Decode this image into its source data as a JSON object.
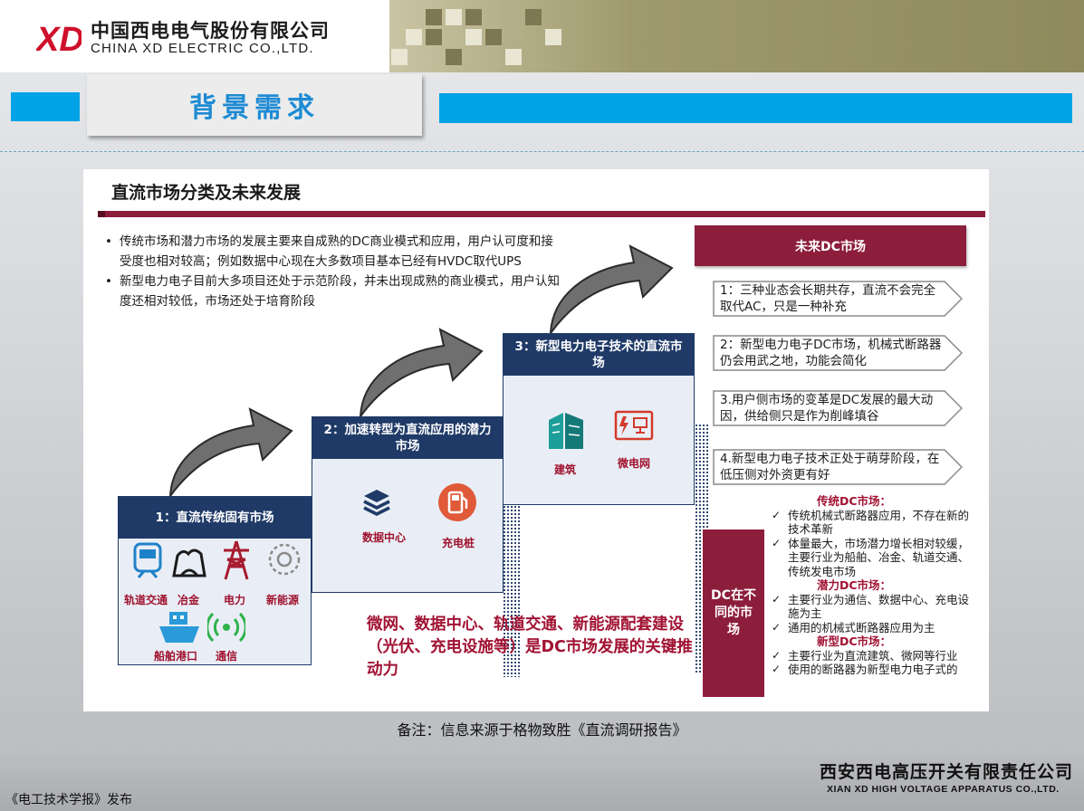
{
  "header": {
    "logo_mark": "XD",
    "company_cn": "中国西电电气股份有限公司",
    "company_en": "CHINA XD ELECTRIC CO.,LTD."
  },
  "section_title": "背景需求",
  "slide": {
    "title": "直流市场分类及未来发展",
    "bullets": [
      "传统市场和潜力市场的发展主要来自成熟的DC商业模式和应用，用户认可度和接受度也相对较高；例如数据中心现在大多数项目基本已经有HVDC取代UPS",
      "新型电力电子目前大多项目还处于示范阶段，并未出现成熟的商业模式，用户认知度还相对较低，市场还处于培育阶段"
    ],
    "stages": [
      {
        "label": "1：直流传统固有市场",
        "items": [
          "轨道交通",
          "冶金",
          "电力",
          "新能源",
          "船舶港口",
          "通信"
        ]
      },
      {
        "label": "2：加速转型为直流应用的潜力市场",
        "items": [
          "数据中心",
          "充电桩"
        ]
      },
      {
        "label": "3：新型电力电子技术的直流市场",
        "items": [
          "建筑",
          "微电网"
        ]
      }
    ],
    "key_driver": "微网、数据中心、轨道交通、新能源配套建设（光伏、充电设施等）是DC市场发展的关键推动力",
    "future": {
      "header": "未来DC市场",
      "points": [
        "1：三种业态会长期共存，直流不会完全取代AC，只是一种补充",
        "2：新型电力电子DC市场，机械式断路器仍会用武之地，功能会简化",
        "3.用户侧市场的变革是DC发展的最大动因，供给侧只是作为削峰填谷",
        "4.新型电力电子技术正处于萌芽阶段，在低压侧对外资更有好"
      ]
    },
    "dc_markets": {
      "label": "DC在不同的市场",
      "groups": [
        {
          "name": "传统DC市场：",
          "items": [
            "传统机械式断路器应用，不存在新的技术革新",
            "体量最大，市场潜力增长相对较缓，主要行业为船舶、冶金、轨道交通、传统发电市场"
          ]
        },
        {
          "name": "潜力DC市场：",
          "items": [
            "主要行业为通信、数据中心、充电设施为主",
            "通用的机械式断路器应用为主"
          ]
        },
        {
          "name": "新型DC市场：",
          "items": [
            "主要行业为直流建筑、微网等行业",
            "使用的断路器为新型电力电子式的"
          ]
        }
      ]
    }
  },
  "note": "备注：信息来源于格物致胜《直流调研报告》",
  "footer": {
    "company_cn": "西安西电高压开关有限责任公司",
    "company_en": "XIAN XD HIGH VOLTAGE APPARATUS CO.,LTD.",
    "publisher": "《电工技术学报》发布"
  },
  "colors": {
    "accent_blue": "#00a3e6",
    "title_blue": "#1e8bd4",
    "maroon": "#8c1d3b",
    "navy": "#1f3a67",
    "key_red": "#a11232"
  }
}
